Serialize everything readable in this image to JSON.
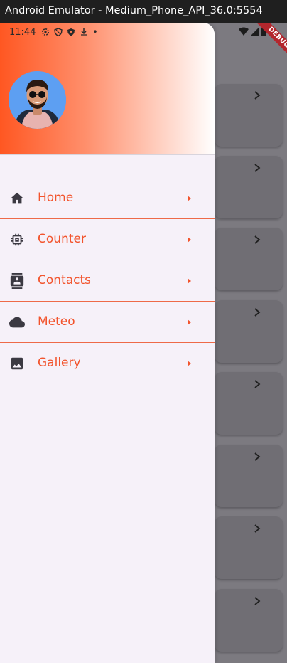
{
  "window": {
    "title": "Android Emulator - Medium_Phone_API_36.0:5554"
  },
  "status_bar": {
    "time": "11:44",
    "dot": "•"
  },
  "debug_banner": {
    "label": "DEBUG"
  },
  "drawer": {
    "avatar": {
      "icon": "avatar-icon"
    },
    "menu": [
      {
        "label": "Home",
        "icon": "home-icon"
      },
      {
        "label": "Counter",
        "icon": "chip-icon"
      },
      {
        "label": "Contacts",
        "icon": "contacts-icon"
      },
      {
        "label": "Meteo",
        "icon": "cloud-icon"
      },
      {
        "label": "Gallery",
        "icon": "image-icon"
      }
    ]
  },
  "colors": {
    "accent": "#f2542d",
    "header_gradient_start": "#ff5722",
    "drawer_background": "#f6f1f9",
    "scrim": "#7c7a80"
  }
}
